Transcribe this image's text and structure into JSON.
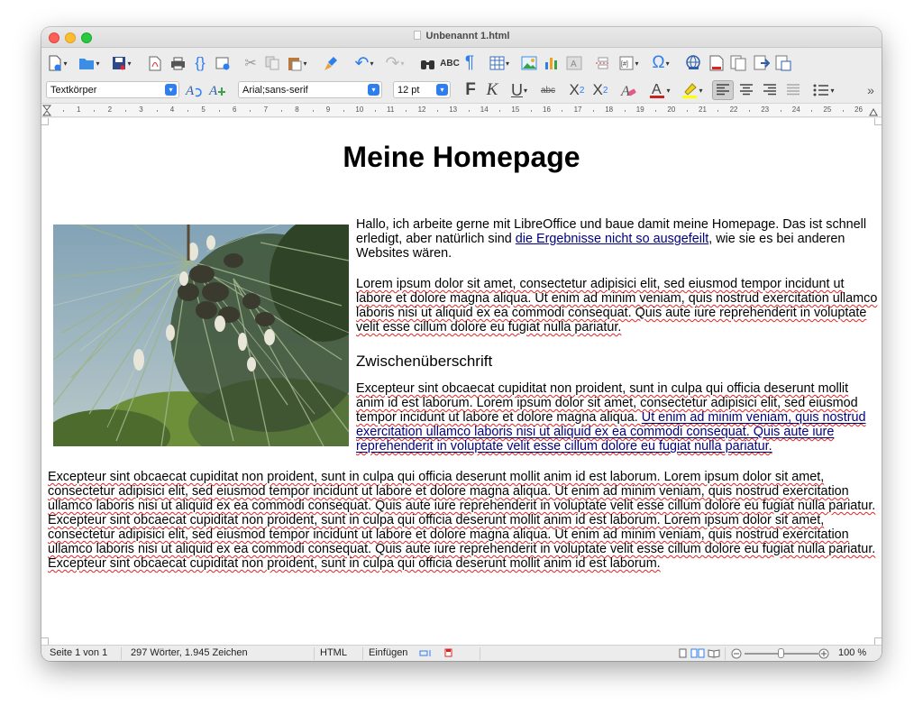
{
  "window": {
    "title": "Unbenannt 1.html"
  },
  "toolbar_formatting": {
    "paragraph_style": "Textkörper",
    "font_name": "Arial;sans-serif",
    "font_size": "12 pt"
  },
  "ruler": {
    "ticks": [
      "1",
      "2",
      "3",
      "4",
      "5",
      "6",
      "7",
      "8",
      "9",
      "10",
      "11",
      "12",
      "13",
      "14",
      "15",
      "16",
      "17",
      "18",
      "19",
      "20",
      "21",
      "22",
      "23",
      "24",
      "25",
      "26"
    ]
  },
  "document": {
    "heading": "Meine Homepage",
    "intro": {
      "before_link": "Hallo, ich arbeite gerne mit LibreOffice und baue damit meine Homepage. Das ist schnell erledigt, aber natürlich sind ",
      "link": "die Ergebnisse nicht so ausgefeilt",
      "after_link": ", wie sie es bei anderen Websites wären."
    },
    "lorem_1": "Lorem ipsum dolor sit amet, consectetur adipisici elit, sed eiusmod tempor incidunt ut labore et dolore magna aliqua. Ut enim ad minim veniam, quis nostrud exercitation ullamco laboris nisi ut aliquid ex ea commodi consequat. Quis aute iure reprehenderit in voluptate velit esse cillum dolore eu fugiat nulla pariatur.",
    "subheading": "Zwischenüberschrift",
    "lorem_2": {
      "plain": "Excepteur sint obcaecat cupiditat non proident, sunt in culpa qui officia deserunt mollit anim id est laborum. Lorem ipsum dolor sit amet, consectetur adipisici elit, sed eiusmod tempor incidunt ut labore et dolore magna aliqua. ",
      "link": "Ut enim ad minim veniam, quis nostrud exercitation ullamco laboris nisi ut aliquid ex ea commodi consequat. Quis aute iure reprehenderit in voluptate velit esse cillum dolore eu fugiat nulla pariatur."
    },
    "lorem_3": "Excepteur sint obcaecat cupiditat non proident, sunt in culpa qui officia deserunt mollit anim id est laborum. Lorem ipsum dolor sit amet, consectetur adipisici elit, sed eiusmod tempor incidunt ut labore et dolore magna aliqua. Ut enim ad minim veniam, quis nostrud exercitation ullamco laboris nisi ut aliquid ex ea commodi consequat. Quis aute iure reprehenderit in voluptate velit esse cillum dolore eu fugiat nulla pariatur. Excepteur sint obcaecat cupiditat non proident, sunt in culpa qui officia deserunt mollit anim id est laborum. Lorem ipsum dolor sit amet, consectetur adipisici elit, sed eiusmod tempor incidunt ut labore et dolore magna aliqua. Ut enim ad minim veniam, quis nostrud exercitation ullamco laboris nisi ut aliquid ex ea commodi consequat. Quis aute iure reprehenderit in voluptate velit esse cillum dolore eu fugiat nulla pariatur. Excepteur sint obcaecat cupiditat non proident, sunt in culpa qui officia deserunt mollit anim id est laborum.",
    "image": {
      "subject": "pine-branch-photo"
    }
  },
  "statusbar": {
    "page": "Seite 1 von 1",
    "word_count": "297 Wörter, 1.945 Zeichen",
    "document_type": "HTML",
    "insert_mode": "Einfügen",
    "zoom": "100 %",
    "zoom_level": 1.0
  },
  "colors": {
    "link": "#000080",
    "spellcheck": "#e32424",
    "accent": "#2f7ef0",
    "font_color_bar": "#c9211e",
    "highlight_bar": "#ffff00"
  },
  "icons": {
    "toolbar_standard": [
      "new-document-icon",
      "open-folder-icon",
      "save-icon",
      "export-pdf-icon",
      "print-icon",
      "toggle-formatting-marks-icon",
      "edit-mode-icon",
      "cut-icon",
      "copy-icon",
      "paste-icon",
      "clone-formatting-icon",
      "undo-icon",
      "redo-icon",
      "find-replace-icon",
      "spelling-icon",
      "formatting-marks-icon",
      "insert-table-icon",
      "insert-image-icon",
      "insert-chart-icon",
      "insert-textbox-icon",
      "insert-page-break-icon",
      "insert-field-icon",
      "special-character-icon",
      "hyperlink-icon",
      "footnote-icon",
      "comment-icon",
      "track-changes-icon",
      "insert-frame-icon",
      "show-draw-functions-icon"
    ],
    "toolbar_formatting": [
      "update-style-icon",
      "new-style-icon",
      "bold-icon",
      "italic-icon",
      "underline-icon",
      "strikethrough-icon",
      "superscript-icon",
      "subscript-icon",
      "clear-formatting-icon",
      "font-color-icon",
      "highlighting-icon",
      "align-left-icon",
      "align-center-icon",
      "align-right-icon",
      "justify-icon",
      "bullet-list-icon",
      "more-options-icon"
    ]
  }
}
